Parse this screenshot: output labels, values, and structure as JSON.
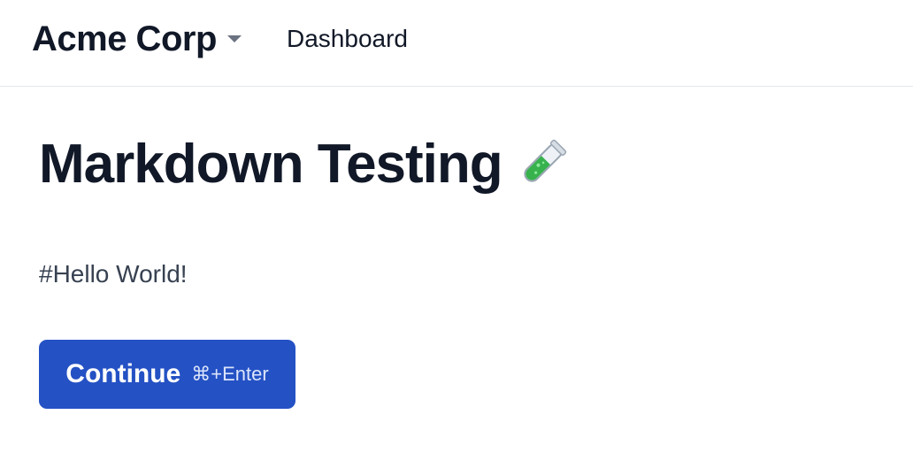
{
  "header": {
    "brand": "Acme Corp",
    "nav_link": "Dashboard"
  },
  "main": {
    "title": "Markdown Testing",
    "title_icon": "test-tube-icon",
    "body_text": "#Hello World!",
    "continue_button": {
      "label": "Continue",
      "shortcut": "⌘+Enter"
    }
  },
  "colors": {
    "primary_button": "#2451c4",
    "text_primary": "#111827",
    "text_secondary": "#374151",
    "divider": "#e5e7eb"
  }
}
